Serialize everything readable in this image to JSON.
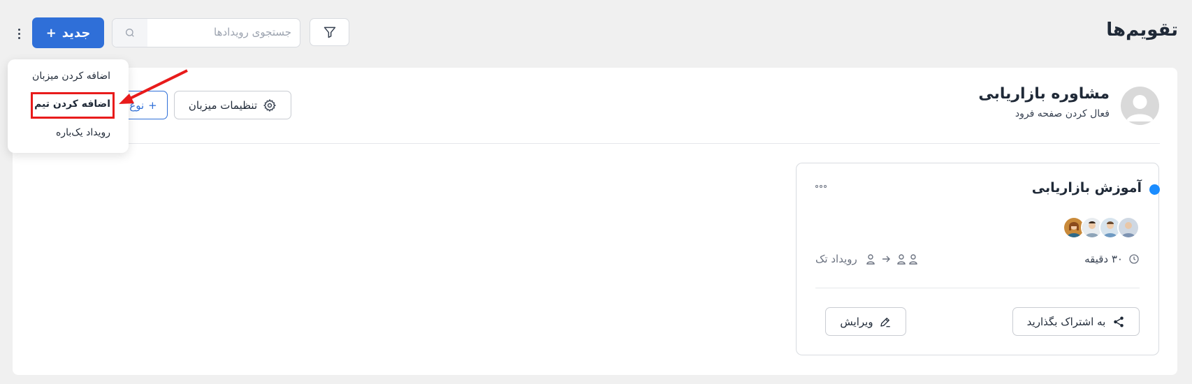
{
  "header": {
    "title": "تقویم‌ها",
    "search_placeholder": "جستجوی رویدادها",
    "new_button_label": "جدید"
  },
  "host": {
    "name": "مشاوره بازاریابی",
    "subtitle": "فعال کردن صفحه فرود",
    "settings_label": "تنظیمات میزبان",
    "new_type_label": "نوع"
  },
  "dropdown": {
    "items": [
      {
        "label": "اضافه کردن میزبان"
      },
      {
        "label": "اضافه کردن تیم"
      },
      {
        "label": "رویداد یک‌باره"
      }
    ],
    "highlighted_index": 1
  },
  "event_card": {
    "title": "آموزش بازاریابی",
    "dot_color": "#1a8cff",
    "duration": "۳۰ دقیقه",
    "kind": "رویداد تک",
    "share_label": "به اشتراک بگذارید",
    "edit_label": "ویرایش",
    "team_member_count": 4
  },
  "colors": {
    "primary": "#2f6fd8",
    "annotation_red": "#e81b1b"
  }
}
